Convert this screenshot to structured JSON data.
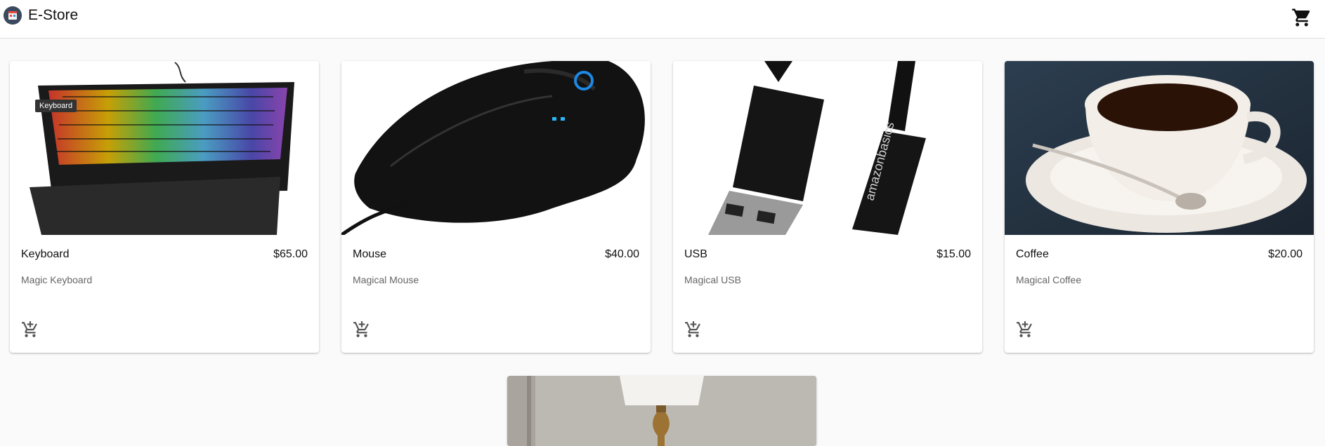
{
  "app": {
    "title": "E-Store",
    "logo_icon": "store-logo-icon",
    "cart_icon": "shopping-cart-icon"
  },
  "products": [
    {
      "name": "Keyboard",
      "price": "$65.00",
      "description": "Magic Keyboard",
      "image_tooltip": "Keyboard"
    },
    {
      "name": "Mouse",
      "price": "$40.00",
      "description": "Magical Mouse"
    },
    {
      "name": "USB",
      "price": "$15.00",
      "description": "Magical USB"
    },
    {
      "name": "Coffee",
      "price": "$20.00",
      "description": "Magical Coffee"
    }
  ],
  "add_icon": "add-shopping-cart-icon",
  "colors": {
    "appbar_bg": "#ffffff",
    "page_bg": "#fafafa",
    "text_primary": "#111111",
    "text_secondary": "#666666"
  }
}
